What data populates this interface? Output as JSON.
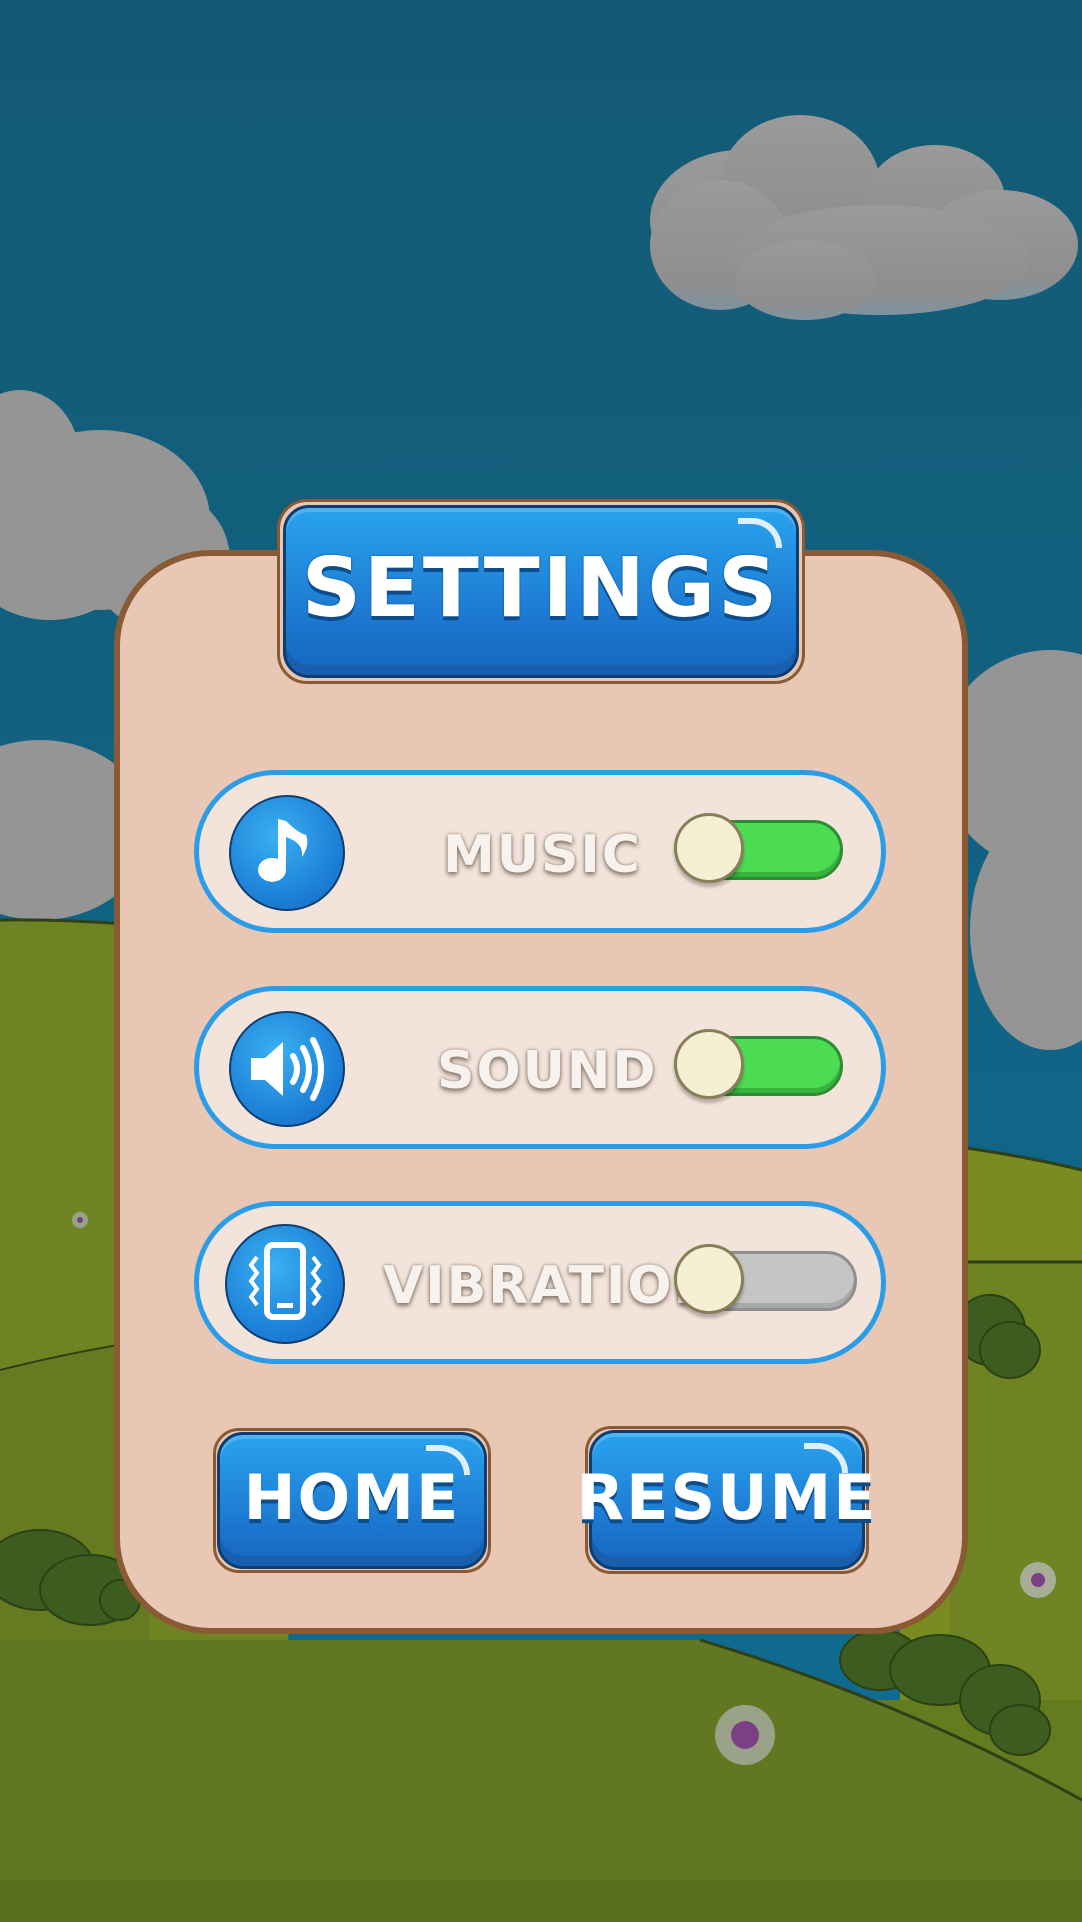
{
  "title": "SETTINGS",
  "settings": [
    {
      "label": "MUSIC",
      "icon": "music-note-icon",
      "enabled": true
    },
    {
      "label": "SOUND",
      "icon": "speaker-icon",
      "enabled": true
    },
    {
      "label": "VIBRATION",
      "icon": "phone-vibration-icon",
      "enabled": false
    }
  ],
  "buttons": {
    "home": "HOME",
    "resume": "RESUME"
  },
  "colors": {
    "sky": "#125a76",
    "grass": "#6a7d22",
    "panel": "#e8c8b4",
    "panel_border": "#8a5a35",
    "button_blue": "#1c7fd6",
    "toggle_on": "#4cdc54",
    "toggle_off": "#c5c5c5"
  }
}
